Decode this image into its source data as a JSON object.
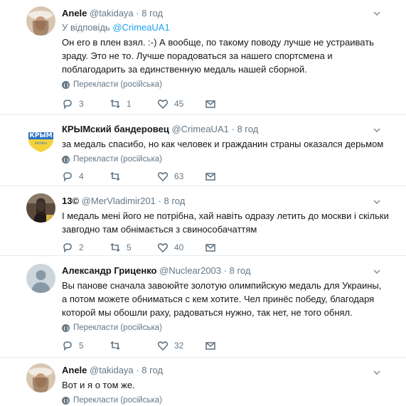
{
  "tweets": [
    {
      "name": "Anele",
      "handle": "@takidaya",
      "time": "8 год",
      "reply_label": "У відповідь",
      "reply_handle": "@CrimeaUA1",
      "text": "Он его в плен взял. :-) А вообще, по такому поводу лучше не устраивать зраду. Это не то. Лучше порадоваться за нашего спортсмена и поблагодарить за единственную медаль нашей сборной.",
      "translate": "Перекласти (російська)",
      "replies": "3",
      "retweets": "1",
      "likes": "45"
    },
    {
      "name": "КРЫМский бандеровец",
      "handle": "@CrimeaUA1",
      "time": "8 год",
      "avatar_text": "КРЫМ",
      "avatar_sub": "УКРАЇНА",
      "text": "за медаль спасибо, но как человек и гражданин страны оказался дерьмом",
      "translate": "Перекласти (російська)",
      "replies": "4",
      "retweets": "",
      "likes": "63"
    },
    {
      "name": "13©",
      "handle": "@MerVladimir201",
      "time": "8 год",
      "text": "І медаль мені його не потрібна, хай навіть одразу летить до москви і скільки завгодно там обнімається з свинособачаттям",
      "replies": "2",
      "retweets": "5",
      "likes": "40"
    },
    {
      "name": "Александр Гриценко",
      "handle": "@Nuclear2003",
      "time": "8 год",
      "text": "Вы панове сначала завоюйте золотую олимпийскую медаль для Украины, а потом можете обниматься с кем хотите. Чел принёс победу, благодаря которой мы обошли раху, радоваться нужно, так нет, не того обнял.",
      "translate": "Перекласти (російська)",
      "replies": "5",
      "retweets": "",
      "likes": "32"
    },
    {
      "name": "Anele",
      "handle": "@takidaya",
      "time": "8 год",
      "text": "Вот и я о том же.",
      "translate": "Перекласти (російська)"
    }
  ],
  "colors": {
    "accent": "#1da1f2",
    "secondary_text": "#657786",
    "divider": "#e6ecf0"
  }
}
